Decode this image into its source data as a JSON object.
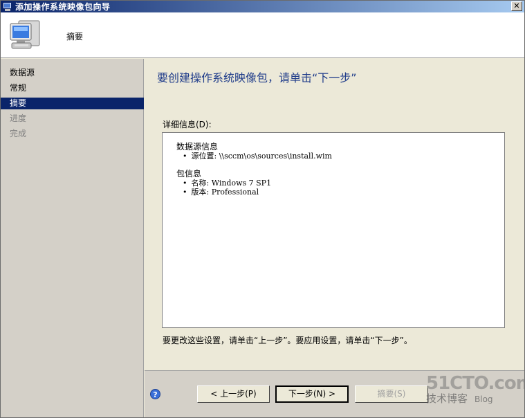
{
  "window": {
    "title": "添加操作系统映像包向导"
  },
  "header": {
    "label": "摘要"
  },
  "nav": {
    "items": [
      {
        "label": "数据源",
        "state": "normal"
      },
      {
        "label": "常规",
        "state": "normal"
      },
      {
        "label": "摘要",
        "state": "active"
      },
      {
        "label": "进度",
        "state": "disabled"
      },
      {
        "label": "完成",
        "state": "disabled"
      }
    ]
  },
  "main": {
    "heading": "要创建操作系统映像包，请单击“下一步”",
    "details_label": "详细信息(D):",
    "details": {
      "source_heading": "数据源信息",
      "source_location": "源位置: \\\\sccm\\os\\sources\\install.wim",
      "package_heading": "包信息",
      "package_name": "名称: Windows 7 SP1",
      "package_version": "版本: Professional"
    },
    "hint": "要更改这些设置，请单击“上一步”。要应用设置，请单击“下一步”。"
  },
  "footer": {
    "prev_label": "< 上一步(P)",
    "next_label": "下一步(N) >",
    "summary_label": "摘要(S)"
  },
  "watermark": {
    "line1": "51CTO.com",
    "line2": "技术博客",
    "line3": "Blog"
  },
  "colors": {
    "active_nav": "#0a246a",
    "heading": "#1f3c8a",
    "titlebar": "#0a246a"
  }
}
